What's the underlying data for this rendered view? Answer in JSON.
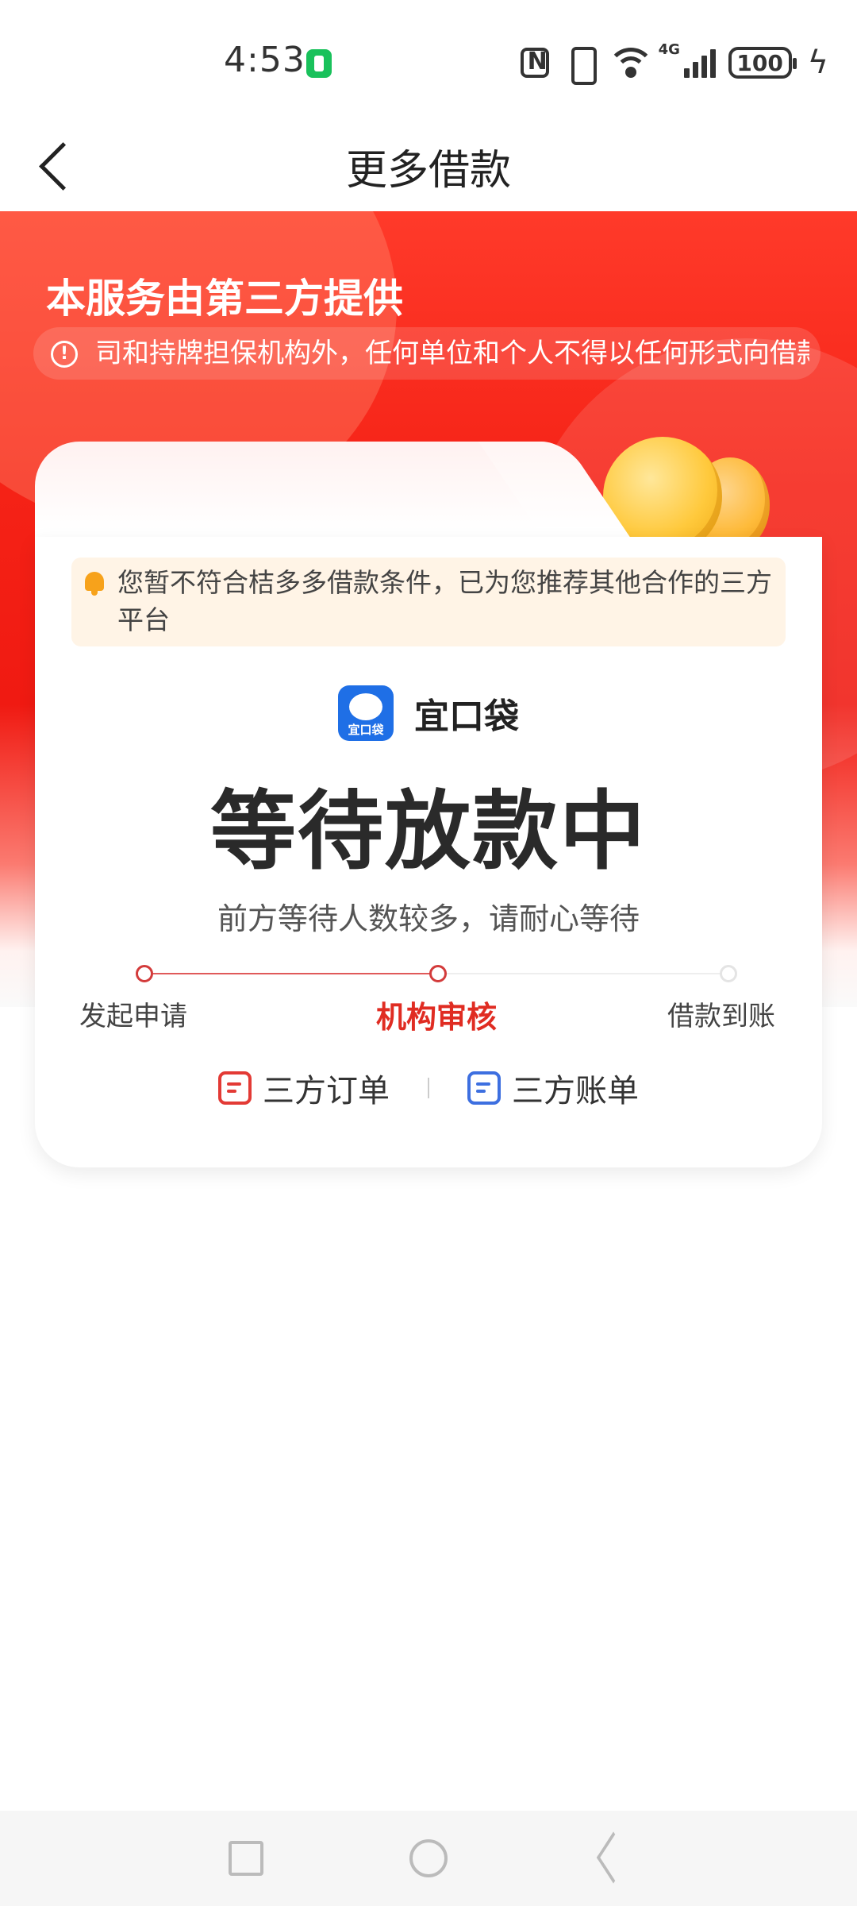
{
  "status_bar": {
    "time": "4:53",
    "network": "4G",
    "battery": "100"
  },
  "header": {
    "title": "更多借款"
  },
  "hero": {
    "provider_note": "本服务由第三方提供",
    "notice": "司和持牌担保机构外，任何单位和个人不得以任何形式向借款"
  },
  "card": {
    "tip": "您暂不符合桔多多借款条件，已为您推荐其他合作的三方平台",
    "platform": {
      "name": "宜口袋"
    },
    "status_title": "等待放款中",
    "status_sub": "前方等待人数较多，请耐心等待",
    "steps": [
      {
        "label": "发起申请",
        "state": "done"
      },
      {
        "label": "机构审核",
        "state": "active"
      },
      {
        "label": "借款到账",
        "state": "todo"
      }
    ],
    "links": {
      "order": "三方订单",
      "bill": "三方账单"
    }
  },
  "colors": {
    "brand_red": "#f01a12",
    "active_step": "#e02c22",
    "order_icon": "#e33a35",
    "bill_icon": "#3d6fe0",
    "tip_background": "#fff4e6"
  },
  "icons": [
    "battery-saver-icon",
    "nfc-icon",
    "vibrate-icon",
    "wifi-icon",
    "signal-icon",
    "battery-icon",
    "charging-icon",
    "back-icon",
    "info-icon",
    "bell-icon",
    "coins-icon",
    "order-icon",
    "bill-icon",
    "recents-icon",
    "home-icon",
    "nav-back-icon"
  ]
}
